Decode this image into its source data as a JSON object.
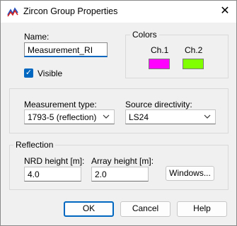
{
  "window": {
    "title": "Zircon Group Properties",
    "close_glyph": "✕"
  },
  "name": {
    "label": "Name:",
    "value": "Measurement_RI"
  },
  "visible": {
    "label": "Visible",
    "checked": true
  },
  "colors": {
    "group_title": "Colors",
    "channels": [
      {
        "label": "Ch.1",
        "color": "#ff00ff"
      },
      {
        "label": "Ch.2",
        "color": "#80ff00"
      }
    ]
  },
  "measurement": {
    "type_label": "Measurement type:",
    "type_value": "1793-5 (reflection)",
    "source_label": "Source directivity:",
    "source_value": "LS24"
  },
  "reflection": {
    "group_title": "Reflection",
    "nrd_label": "NRD height [m]:",
    "nrd_value": "4.0",
    "array_label": "Array height [m]:",
    "array_value": "2.0",
    "windows_button": "Windows..."
  },
  "buttons": {
    "ok": "OK",
    "cancel": "Cancel",
    "help": "Help"
  },
  "accent_color": "#0067c0"
}
